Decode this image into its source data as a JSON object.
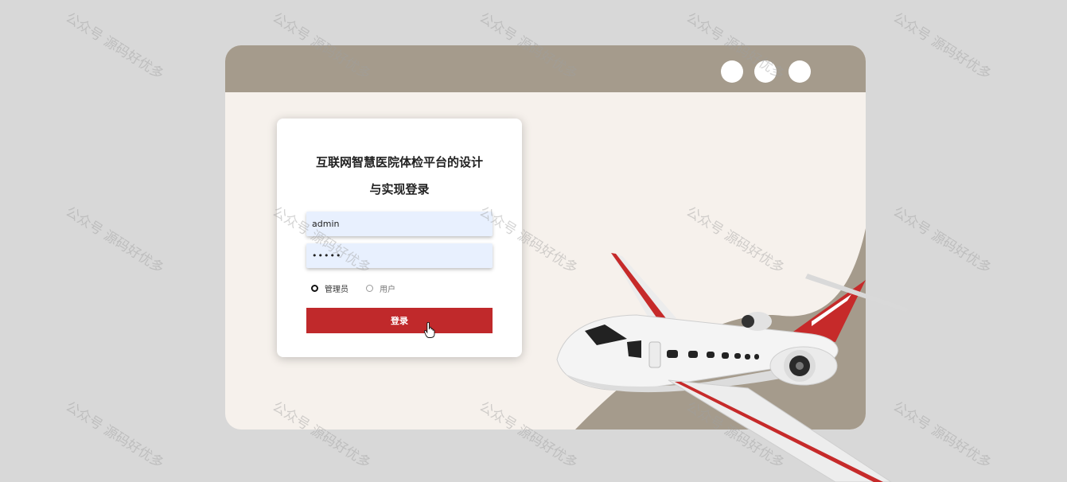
{
  "card": {
    "title_line1": "互联网智慧医院体检平台的设计",
    "title_line2": "与实现登录"
  },
  "form": {
    "username_value": "admin",
    "password_value": "•••••",
    "roles": [
      {
        "label": "管理员",
        "checked": true
      },
      {
        "label": "用户",
        "checked": false
      }
    ],
    "login_label": "登录"
  },
  "watermark_text": "公众号 源码好优多",
  "colors": {
    "titlebar": "#a59b8c",
    "window_bg": "#f6f1ec",
    "page_bg": "#d8d8d8",
    "login_button": "#c0292b",
    "input_bg": "#e8f0fe"
  }
}
